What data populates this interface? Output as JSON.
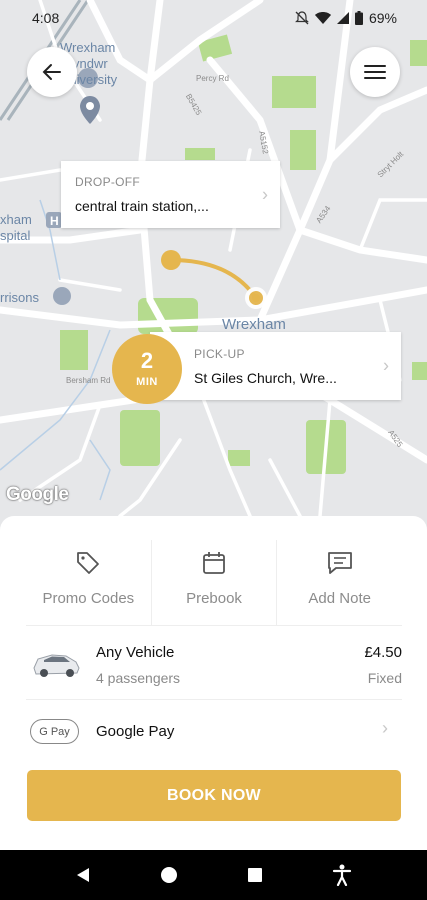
{
  "status_bar": {
    "time": "4:08",
    "battery": "69%"
  },
  "map": {
    "labels": {
      "university": "Wrexham Glyndwr University",
      "hospital": "xham spital",
      "morrisons": "rrisons",
      "wrexham": "Wrexham",
      "road_a5152": "A5152",
      "road_b5425": "B5425",
      "road_a534": "A534",
      "road_a525": "A525",
      "road_stryt": "Stryt Holt",
      "road_percy": "Percy Rd",
      "road_bersham": "Bersham Rd"
    },
    "attribution": "Google"
  },
  "dropoff": {
    "label": "DROP-OFF",
    "value": "central train station,..."
  },
  "pickup": {
    "label": "PICK-UP",
    "value": "St Giles Church, Wre..."
  },
  "eta": {
    "number": "2",
    "unit": "MIN"
  },
  "options": {
    "promo": "Promo Codes",
    "prebook": "Prebook",
    "note": "Add Note"
  },
  "vehicle": {
    "name": "Any Vehicle",
    "passengers": "4 passengers",
    "price": "£4.50",
    "price_type": "Fixed"
  },
  "payment": {
    "badge": "G Pay",
    "name": "Google Pay"
  },
  "book_button": "BOOK NOW",
  "colors": {
    "accent": "#e5b64e",
    "map_bg": "#e6e7e9",
    "park": "#b5db8e"
  },
  "icons": {
    "back": "arrow-left-icon",
    "menu": "hamburger-menu-icon",
    "promo": "tag-icon",
    "prebook": "calendar-icon",
    "note": "message-icon",
    "vehicle": "car-icon"
  }
}
